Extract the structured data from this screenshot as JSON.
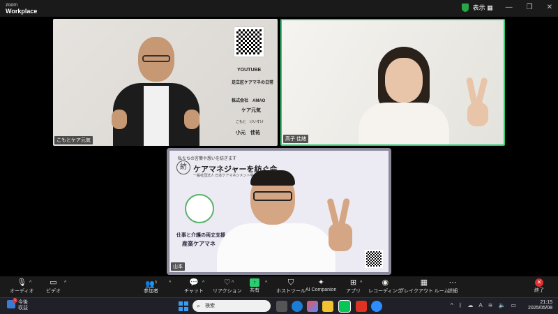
{
  "titlebar": {
    "logo_top": "zoom",
    "logo_bottom": "Workplace",
    "view_label": "表示",
    "view_icon": "grid-icon"
  },
  "tiles": [
    {
      "name": "こもとケア元気",
      "slide": {
        "youtube": "YOUTUBE",
        "channel": "足立区ケアマネの日常",
        "company": "株式会社　AMAO",
        "brand": "ケア元気",
        "kana": "こもと　けいすけ",
        "person": "小元　佳祐"
      }
    },
    {
      "name": "高子 佳緒"
    },
    {
      "name": "山本",
      "slide": {
        "tagline": "私たちの言葉や想いを紡ぎます",
        "kanji": "紡",
        "title": "ケアマネジャーを紡ぐ会",
        "subtitle": "一般社団法人 日本ケアマネジメント学会認定",
        "line1": "仕事と介護の両立支援",
        "line2": "産業ケアマネ"
      }
    }
  ],
  "toolbar": {
    "audio": "オーディオ",
    "video": "ビデオ",
    "participants": "参加者",
    "participants_count": "3",
    "chat": "チャット",
    "reactions": "リアクション",
    "share": "共有",
    "host_tools": "ホストツール",
    "ai": "AI Companion",
    "apps": "アプリ",
    "record": "レコーディング",
    "breakout": "ブレイクアウト ルーム",
    "more": "詳細",
    "end": "終了"
  },
  "taskbar": {
    "weather_line1": "今後",
    "weather_line2": "収益",
    "weather_badge": "1",
    "search_placeholder": "検索",
    "time": "21:15",
    "date": "2025/05/08",
    "ime": "A"
  }
}
